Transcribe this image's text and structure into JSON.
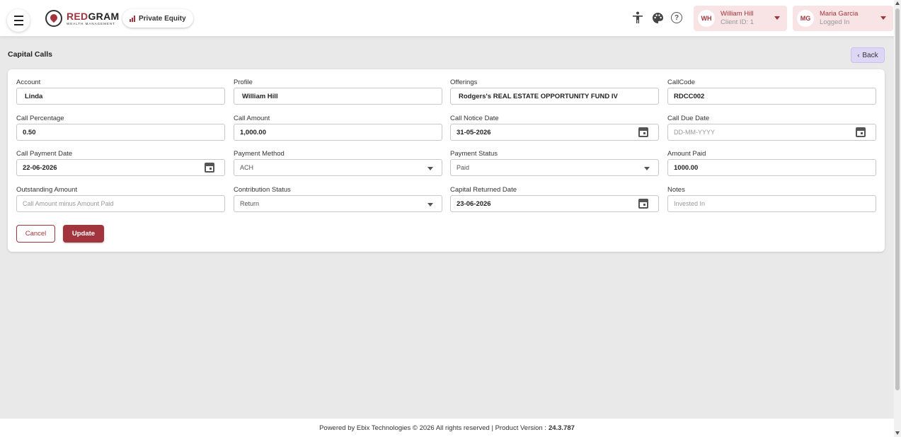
{
  "header": {
    "logo_main_red": "RED",
    "logo_main_dark": "GRAM",
    "logo_sub": "WEALTH MANAGEMENT",
    "module_label": "Private Equity",
    "client": {
      "initials": "WH",
      "name": "William Hill",
      "sub": "Client ID: 1"
    },
    "user": {
      "initials": "MG",
      "name": "Maria Garcia",
      "sub": "Logged In"
    },
    "icons": [
      "menu-icon",
      "accessibility-icon",
      "palette-icon",
      "help-icon"
    ]
  },
  "page": {
    "title": "Capital Calls",
    "back_label": "Back"
  },
  "form": {
    "account": {
      "label": "Account",
      "value": "Linda"
    },
    "profile": {
      "label": "Profile",
      "value": "William Hill"
    },
    "offerings": {
      "label": "Offerings",
      "value": "Rodgers's REAL ESTATE OPPORTUNITY FUND IV"
    },
    "callcode": {
      "label": "CallCode",
      "value": "RDCC002"
    },
    "call_percentage": {
      "label": "Call Percentage",
      "value": "0.50"
    },
    "call_amount": {
      "label": "Call Amount",
      "value": "1,000.00"
    },
    "call_notice_date": {
      "label": "Call Notice Date",
      "value": "31-05-2026"
    },
    "call_due_date": {
      "label": "Call Due Date",
      "placeholder": "DD-MM-YYYY"
    },
    "call_payment_date": {
      "label": "Call Payment Date",
      "value": "22-06-2026"
    },
    "payment_method": {
      "label": "Payment Method",
      "value": "ACH"
    },
    "payment_status": {
      "label": "Payment Status",
      "value": "Paid"
    },
    "amount_paid": {
      "label": "Amount Paid",
      "value": "1000.00"
    },
    "outstanding_amount": {
      "label": "Outstanding Amount",
      "placeholder": "Call Amount minus Amount Paid"
    },
    "contribution_status": {
      "label": "Contribution Status",
      "value": "Return"
    },
    "capital_returned_date": {
      "label": "Capital Returned Date",
      "value": "23-06-2026"
    },
    "notes": {
      "label": "Notes",
      "placeholder": "Invested In"
    },
    "cancel_label": "Cancel",
    "update_label": "Update"
  },
  "footer": {
    "text": "Powered by Ebix Technologies © 2026 All rights reserved | Product Version :",
    "version": "24.3.787"
  },
  "colors": {
    "accent": "#a1343d",
    "chip_bg": "#f8e4e4",
    "back_bg": "#ddd6f5",
    "page_bg": "#e9e9e9"
  }
}
